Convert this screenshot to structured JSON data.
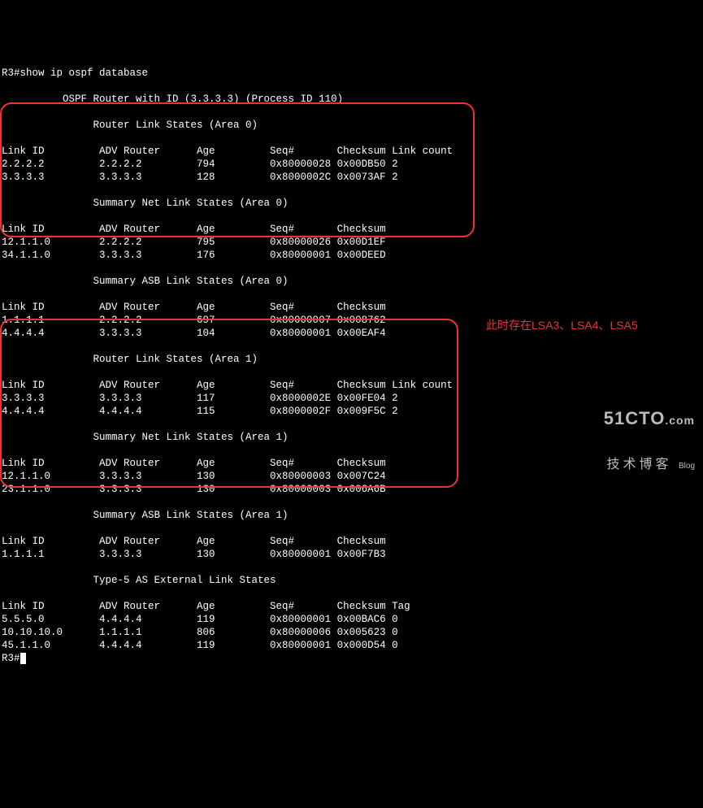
{
  "prompt": "R3#",
  "end_prompt": "R3#",
  "command": "show ip ospf database",
  "header": "          OSPF Router with ID (3.3.3.3) (Process ID 110)",
  "section_rls0": "               Router Link States (Area 0)",
  "cols_rls": "Link ID         ADV Router      Age         Seq#       Checksum Link count",
  "rls0_r1": "2.2.2.2         2.2.2.2         794         0x80000028 0x00DB50 2",
  "rls0_r2": "3.3.3.3         3.3.3.3         128         0x8000002C 0x0073AF 2",
  "section_snls0": "               Summary Net Link States (Area 0)",
  "cols_sum": "Link ID         ADV Router      Age         Seq#       Checksum",
  "snls0_r1": "12.1.1.0        2.2.2.2         795         0x80000026 0x00D1EF",
  "snls0_r2": "34.1.1.0        3.3.3.3         176         0x80000001 0x00DEED",
  "section_sasb0": "               Summary ASB Link States (Area 0)",
  "sasb0_r1": "1.1.1.1         2.2.2.2         697         0x80000007 0x008762",
  "sasb0_r2": "4.4.4.4         3.3.3.3         104         0x80000001 0x00EAF4",
  "section_rls1": "               Router Link States (Area 1)",
  "rls1_r1": "3.3.3.3         3.3.3.3         117         0x8000002E 0x00FE04 2",
  "rls1_r2": "4.4.4.4         4.4.4.4         115         0x8000002F 0x009F5C 2",
  "section_snls1": "               Summary Net Link States (Area 1)",
  "snls1_r1": "12.1.1.0        3.3.3.3         130         0x80000003 0x007C24",
  "snls1_r2": "23.1.1.0        3.3.3.3         130         0x80000003 0x006A6B",
  "section_sasb1": "               Summary ASB Link States (Area 1)",
  "sasb1_r1": "1.1.1.1         3.3.3.3         130         0x80000001 0x00F7B3",
  "section_t5": "               Type-5 AS External Link States",
  "cols_t5": "Link ID         ADV Router      Age         Seq#       Checksum Tag",
  "t5_r1": "5.5.5.0         4.4.4.4         119         0x80000001 0x00BAC6 0",
  "t5_r2": "10.10.10.0      1.1.1.1         806         0x80000006 0x005623 0",
  "t5_r3": "45.1.1.0        4.4.4.4         119         0x80000001 0x000D54 0",
  "annotation1": "此时存在LSA3、LSA4、LSA5",
  "watermark_big": "51CTO",
  "watermark_com": ".com",
  "watermark_sub": "技术博客",
  "watermark_tag": "Blog"
}
